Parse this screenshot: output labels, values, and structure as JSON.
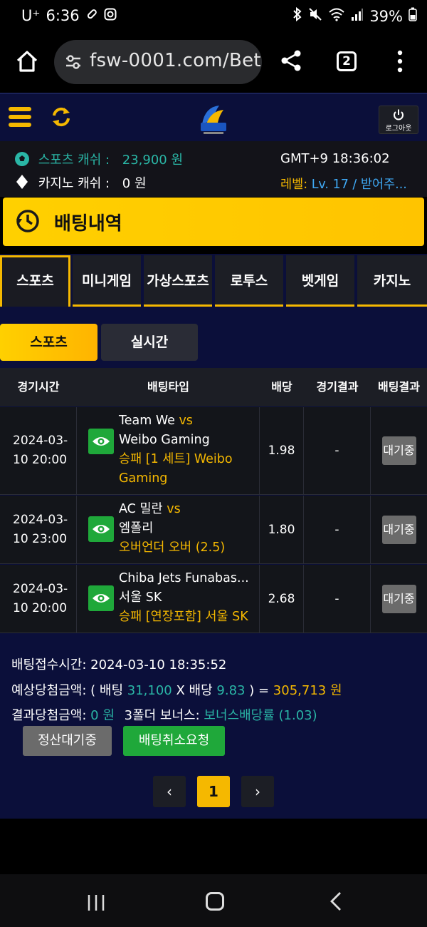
{
  "status_bar": {
    "carrier": "U⁺",
    "time": "6:36",
    "battery": "39%"
  },
  "browser": {
    "url": "fsw-0001.com/Bet",
    "tab_count": "2"
  },
  "header": {
    "logout_label": "로그아웃"
  },
  "info": {
    "sports_cash_label": "스포츠 캐쉬 :",
    "sports_cash_value": "23,900 원",
    "casino_cash_label": "카지노 캐쉬 :",
    "casino_cash_value": "0 원",
    "server_time": "GMT+9 18:36:02",
    "level_label": "레벨:",
    "level_value": "Lv. 17 / 받어주..."
  },
  "page_title": "배팅내역",
  "category_tabs": [
    "스포츠",
    "미니게임",
    "가상스포츠",
    "로투스",
    "벳게임",
    "카지노"
  ],
  "sub_tabs": [
    "스포츠",
    "실시간"
  ],
  "table": {
    "headers": [
      "경기시간",
      "배팅타입",
      "배당",
      "경기결과",
      "배팅결과"
    ],
    "rows": [
      {
        "date": "2024-03-",
        "time": "10 20:00",
        "home": "Team We",
        "vs": "vs",
        "away": "Weibo Gaming",
        "pick_line1": "승패 [1 세트] Weibo",
        "pick_line2": "Gaming",
        "odds": "1.98",
        "result": "-",
        "status": "대기중"
      },
      {
        "date": "2024-03-",
        "time": "10 23:00",
        "home": "AC 밀란",
        "vs": "vs",
        "away": "엠폴리",
        "pick_line1": "오버언더 오버 (2.5)",
        "odds": "1.80",
        "result": "-",
        "status": "대기중"
      },
      {
        "date": "2024-03-",
        "time": "10 20:00",
        "home": "Chiba Jets Funabas...",
        "away": "서울 SK",
        "pick_line1": "승패 [연장포함] 서울 SK",
        "odds": "2.68",
        "result": "-",
        "status": "대기중"
      }
    ]
  },
  "summary": {
    "bet_time_label": "배팅접수시간:",
    "bet_time_value": "2024-03-10 18:35:52",
    "expected_label": "예상당첨금액:",
    "open_paren": "( 배팅",
    "bet_amount": "31,100",
    "x_label": "X 배당",
    "total_odds": "9.83",
    "eq_label": ") =",
    "expected_value": "305,713 원",
    "result_label": "결과당첨금액:",
    "result_value": "0 원",
    "bonus_label": "3폴더 보너스:",
    "bonus_value": "보너스배당률 (1.03)"
  },
  "buttons": {
    "settle_pending": "정산대기중",
    "cancel_request": "배팅취소요청"
  },
  "pagination": {
    "prev": "‹",
    "current": "1",
    "next": "›"
  }
}
